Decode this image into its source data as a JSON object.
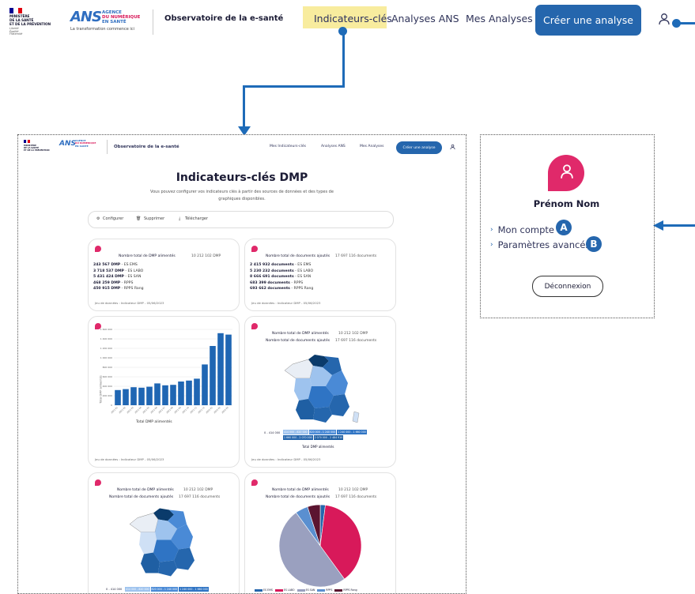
{
  "header": {
    "gov_logo_lines": [
      "MINISTÈRE",
      "DE LA SANTÉ",
      "ET DE LA PRÉVENTION"
    ],
    "gov_motto": [
      "Liberté",
      "Égalité",
      "Fraternité"
    ],
    "ans_mark": "ANS",
    "ans_words": [
      "AGENCE",
      "DU NUMÉRIQUE",
      "EN SANTÉ"
    ],
    "ans_tagline": "La transformation commence ici",
    "site_title": "Observatoire de la e-santé",
    "nav": [
      "Indicateurs-clés",
      "Analyses ANS",
      "Mes Analyses"
    ],
    "create_button": "Créer une analyse",
    "highlight_color": "#f8ec9e",
    "accent_color": "#2566ad"
  },
  "screenshot": {
    "header": {
      "site_title": "Observatoire de la e-santé",
      "nav": [
        "Mes Indicateurs-clés",
        "Analyses ANS",
        "Mes Analyses"
      ],
      "create_button": "Créer une analyse"
    },
    "title": "Indicateurs-clés DMP",
    "subtitle": "Vous pouvez configurer vos indicateurs clés à partir des sources de données et des types de graphiques disponibles.",
    "toolbar": [
      "Configurer",
      "Supprimer",
      "Télécharger"
    ],
    "cards": [
      {
        "title": "Nombre total de DMP alimentés",
        "total": "10 212 102 DMP",
        "lines": [
          {
            "value": "243 567 DMP",
            "label": " - ES EMS"
          },
          {
            "value": "3 718 537 DMP",
            "label": " - ES LABO"
          },
          {
            "value": "5 431 424 DMP",
            "label": " - ES SAN"
          },
          {
            "value": "468 259 DMP",
            "label": " - RPPS"
          },
          {
            "value": "450 915 DMP",
            "label": " - RPPS Rang"
          }
        ],
        "footer": "Jeu de données : Indicateur DMP - 05/06/2023"
      },
      {
        "title": "Nombre total de documents ajoutés",
        "total": "17 697 116 documents",
        "lines": [
          {
            "value": "2 415 932 documents",
            "label": " - ES EMS"
          },
          {
            "value": "5 230 232 documents",
            "label": " - ES LABO"
          },
          {
            "value": "8 666 691 documents",
            "label": " - ES SAN"
          },
          {
            "value": "683 399 documents",
            "label": " - RPPS"
          },
          {
            "value": "693 662 documents",
            "label": " - RPPS Rang"
          }
        ],
        "footer": "Jeu de données : Indicateur DMP - 05/06/2023"
      }
    ],
    "bar_card": {
      "xlabel": "Total DMP alimentés",
      "ylabel": "Total DMP alimentés",
      "footer": "Jeu de données : Indicateur DMP - 05/06/2023"
    },
    "map_card": {
      "title1": "Nombre total de DMP alimentés",
      "total1": "10 212 102 DMP",
      "title2": "Nombre total de documents ajoutés",
      "total2": "17 697 116 documents",
      "legend_title": "Total DMP alimentés",
      "legend_start": "0 - 414 000",
      "legend_ranges": [
        "414 000 - 820 000",
        "820 000 - 1 240 000",
        "1 240 000 - 1 660 000",
        "1 660 000 - 2 070 000",
        "2 070 000 - 2 484 910"
      ],
      "footer": "Jeu de données : Indicateur DMP - 05/06/2023"
    },
    "map_card2": {
      "title1": "Nombre total de DMP alimentés",
      "total1": "10 212 102 DMP",
      "title2": "Nombre total de documents ajoutés",
      "total2": "17 697 116 documents",
      "legend_start": "0 - 414 000",
      "legend_ranges": [
        "414 000 - 820 000",
        "820 000 - 1 240 000",
        "1 240 000 - 1 660 000"
      ]
    },
    "pie_card": {
      "title1": "Nombre total de DMP alimentés",
      "total1": "10 212 102 DMP",
      "title2": "Nombre total de documents ajoutés",
      "total2": "17 697 116 documents",
      "legend": [
        "ES EMS",
        "ES LABO",
        "ES SAN",
        "RPPS",
        "RPPS Rang"
      ]
    }
  },
  "chart_data": {
    "type": "bar",
    "categories": [
      "2021-01",
      "2021-02",
      "2021-03",
      "2021-04",
      "2021-05",
      "2021-06",
      "2021-07",
      "2021-08",
      "2021-09",
      "2021-10",
      "2021-11",
      "2021-12",
      "2022-01",
      "2022-02",
      "2022-03"
    ],
    "values": [
      320000,
      340000,
      380000,
      370000,
      390000,
      460000,
      420000,
      430000,
      500000,
      520000,
      560000,
      860000,
      1250000,
      1520000,
      1490000
    ],
    "ylim": [
      0,
      1600000
    ],
    "yticks": [
      "0",
      "200 000",
      "400 000",
      "600 000",
      "800 000",
      "1 000 000",
      "1 200 000",
      "1 400 000",
      "1 600 000"
    ],
    "xlabel": "Total DMP alimentés",
    "ylabel": "Total DMP alimentés",
    "color": "#1f66b3"
  },
  "pie_data": {
    "type": "pie",
    "labels": [
      "ES EMS",
      "ES LABO",
      "ES SAN",
      "RPPS",
      "RPPS Rang"
    ],
    "values": [
      2,
      38,
      50,
      5,
      5
    ],
    "colors": [
      "#2566ad",
      "#d8195a",
      "#9aa0bf",
      "#5a8fd0",
      "#5b1430"
    ]
  },
  "user_panel": {
    "name": "Prénom Nom",
    "links": [
      "Mon compte",
      "Paramètres avancés"
    ],
    "badges": [
      "A",
      "B"
    ],
    "logout": "Déconnexion"
  }
}
